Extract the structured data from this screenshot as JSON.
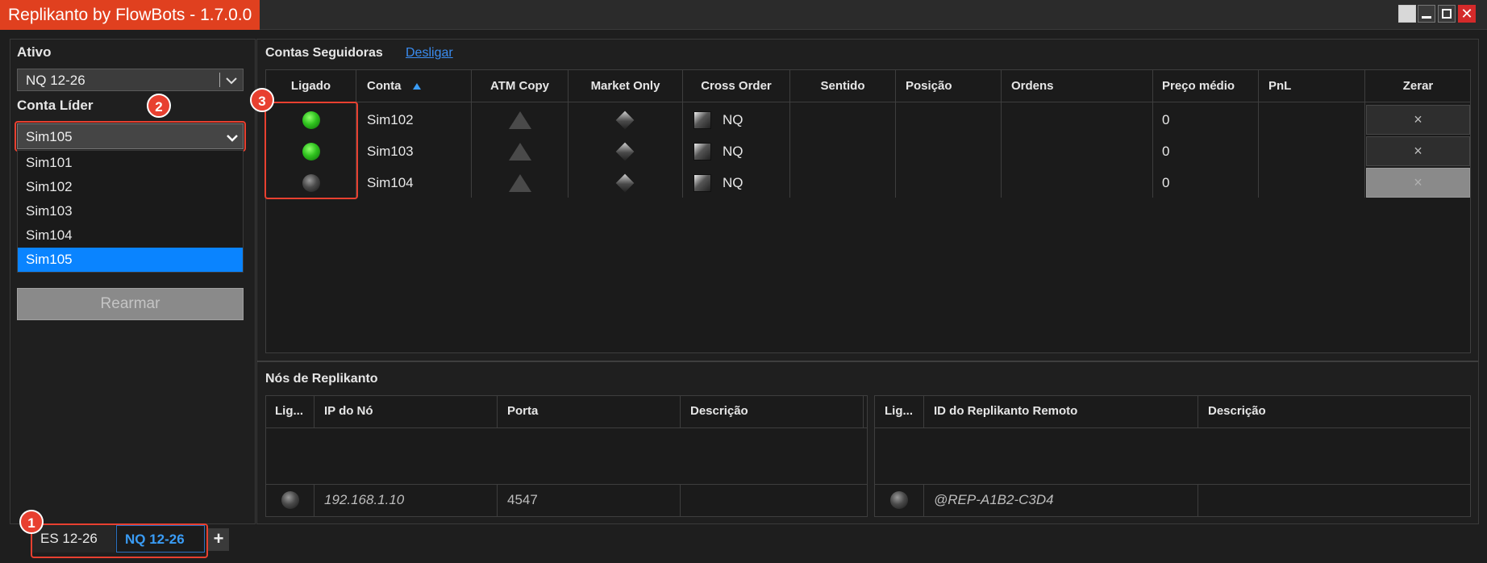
{
  "window": {
    "title": "Replikanto by FlowBots - 1.7.0.0",
    "controls": [
      "minimize",
      "maximize",
      "close"
    ]
  },
  "left_panel": {
    "asset_label": "Ativo",
    "asset_value": "NQ 12-26",
    "leader_label": "Conta Líder",
    "leader_value": "Sim105",
    "leader_options": [
      "Sim101",
      "Sim102",
      "Sim103",
      "Sim104",
      "Sim105"
    ],
    "leader_selected_index": 4,
    "rearm_label": "Rearmar"
  },
  "followers": {
    "title": "Contas Seguidoras",
    "disconnect_link": "Desligar",
    "columns": [
      "Ligado",
      "Conta",
      "ATM Copy",
      "Market Only",
      "Cross Order",
      "Sentido",
      "Posição",
      "Ordens",
      "Preço médio",
      "PnL",
      "Zerar"
    ],
    "sort_column": "Conta",
    "sort_direction": "ascending",
    "rows": [
      {
        "on": true,
        "account": "Sim102",
        "cross": "NQ",
        "direction": "",
        "position": "",
        "orders": "",
        "avg_price": "0",
        "pnl": "",
        "zero": "×",
        "zero_enabled": true
      },
      {
        "on": true,
        "account": "Sim103",
        "cross": "NQ",
        "direction": "",
        "position": "",
        "orders": "",
        "avg_price": "0",
        "pnl": "",
        "zero": "×",
        "zero_enabled": true
      },
      {
        "on": false,
        "account": "Sim104",
        "cross": "NQ",
        "direction": "",
        "position": "",
        "orders": "",
        "avg_price": "0",
        "pnl": "",
        "zero": "×",
        "zero_enabled": false
      }
    ]
  },
  "nodes": {
    "title": "Nós de Replikanto",
    "left_table": {
      "columns": [
        "Lig...",
        "IP do Nó",
        "Porta",
        "Descrição"
      ],
      "rows": [
        {
          "on": false,
          "ip": "192.168.1.10",
          "port": "4547",
          "description": ""
        }
      ]
    },
    "right_table": {
      "columns": [
        "Lig...",
        "ID do Replikanto Remoto",
        "Descrição"
      ],
      "rows": [
        {
          "on": false,
          "remote_id": "@REP-A1B2-C3D4",
          "description": ""
        }
      ]
    }
  },
  "tabs": {
    "items": [
      "ES 12-26",
      "NQ 12-26"
    ],
    "active_index": 1,
    "add_label": "+"
  },
  "callouts": [
    "1",
    "2",
    "3"
  ],
  "colors": {
    "title_bg": "#e0401f",
    "accent": "#0a84ff",
    "callout": "#e84030",
    "led_on": "#2fc21e",
    "link": "#3a8cf0"
  }
}
